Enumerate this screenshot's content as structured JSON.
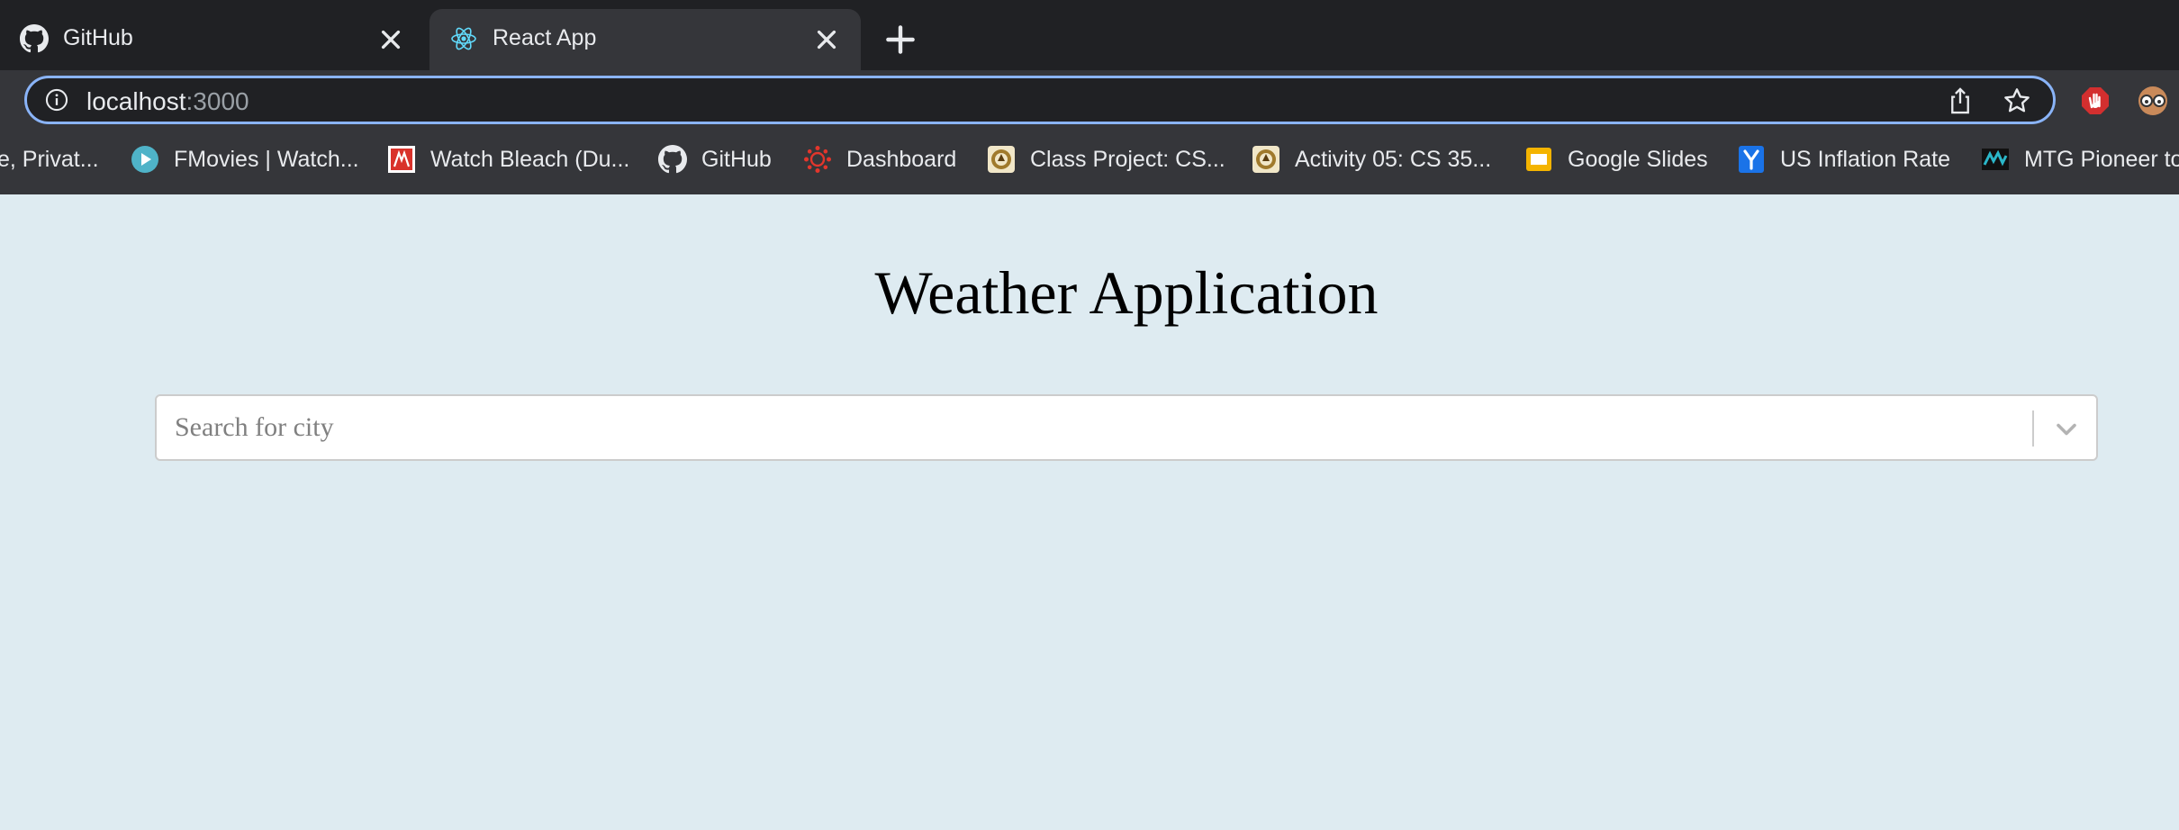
{
  "browser": {
    "tabs": [
      {
        "title": "GitHub",
        "icon": "github-icon",
        "active": false
      },
      {
        "title": "React App",
        "icon": "react-icon",
        "active": true
      }
    ],
    "address": {
      "host": "localhost",
      "port": ":3000"
    },
    "bookmarks": [
      {
        "label": "e, Privat...",
        "icon": "none"
      },
      {
        "label": "FMovies | Watch...",
        "icon": "play-icon"
      },
      {
        "label": "Watch Bleach (Du...",
        "icon": "site-icon"
      },
      {
        "label": "GitHub",
        "icon": "github-icon"
      },
      {
        "label": "Dashboard",
        "icon": "canvas-icon"
      },
      {
        "label": "Class Project: CS...",
        "icon": "crest-icon"
      },
      {
        "label": "Activity 05: CS 35...",
        "icon": "crest-icon"
      },
      {
        "label": "Google Slides",
        "icon": "slides-icon"
      },
      {
        "label": "US Inflation Rate",
        "icon": "ycharts-icon"
      },
      {
        "label": "MTG Pioneer to",
        "icon": "mtg-icon"
      }
    ],
    "colors": {
      "tabstrip": "#202124",
      "toolbar": "#35363a",
      "focus_ring": "#8ab4f8"
    }
  },
  "page": {
    "title": "Weather Application",
    "search": {
      "placeholder": "Search for city",
      "value": ""
    },
    "background": "#deebf1"
  }
}
